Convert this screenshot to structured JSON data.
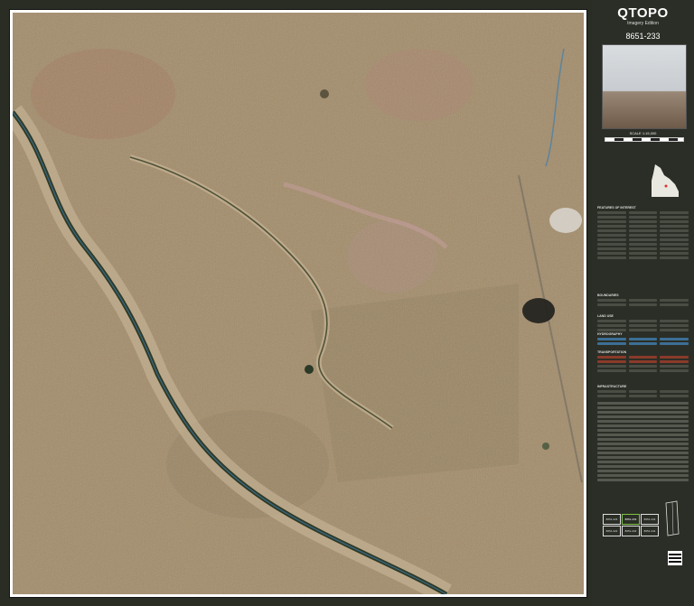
{
  "brand": {
    "title": "QTOPO",
    "edition": "Imagery Edition"
  },
  "sheet_number": "8651-233",
  "scale_text": "SCALE 1:15,000",
  "grid": {
    "cells": [
      {
        "id": "8651-223",
        "current": false
      },
      {
        "id": "8651-233",
        "current": true
      },
      {
        "id": "8651-243",
        "current": false
      },
      {
        "id": "8651-222",
        "current": false
      },
      {
        "id": "8651-232",
        "current": false
      },
      {
        "id": "8651-242",
        "current": false
      }
    ]
  },
  "legend_headings": [
    "FEATURES OF INTEREST",
    "BOUNDARIES",
    "LAND USE",
    "HYDROGRAPHY",
    "TRANSPORTATION",
    "INFRASTRUCTURE"
  ],
  "colors": {
    "panel_bg": "#2b2e26",
    "accent": "#7cc242",
    "terrain_base": "#a08a66",
    "creek": "#2f3a26",
    "water": "#3c7fb0"
  },
  "icons": [
    "queensland-map-icon",
    "qr-code-icon",
    "compass-icon"
  ]
}
